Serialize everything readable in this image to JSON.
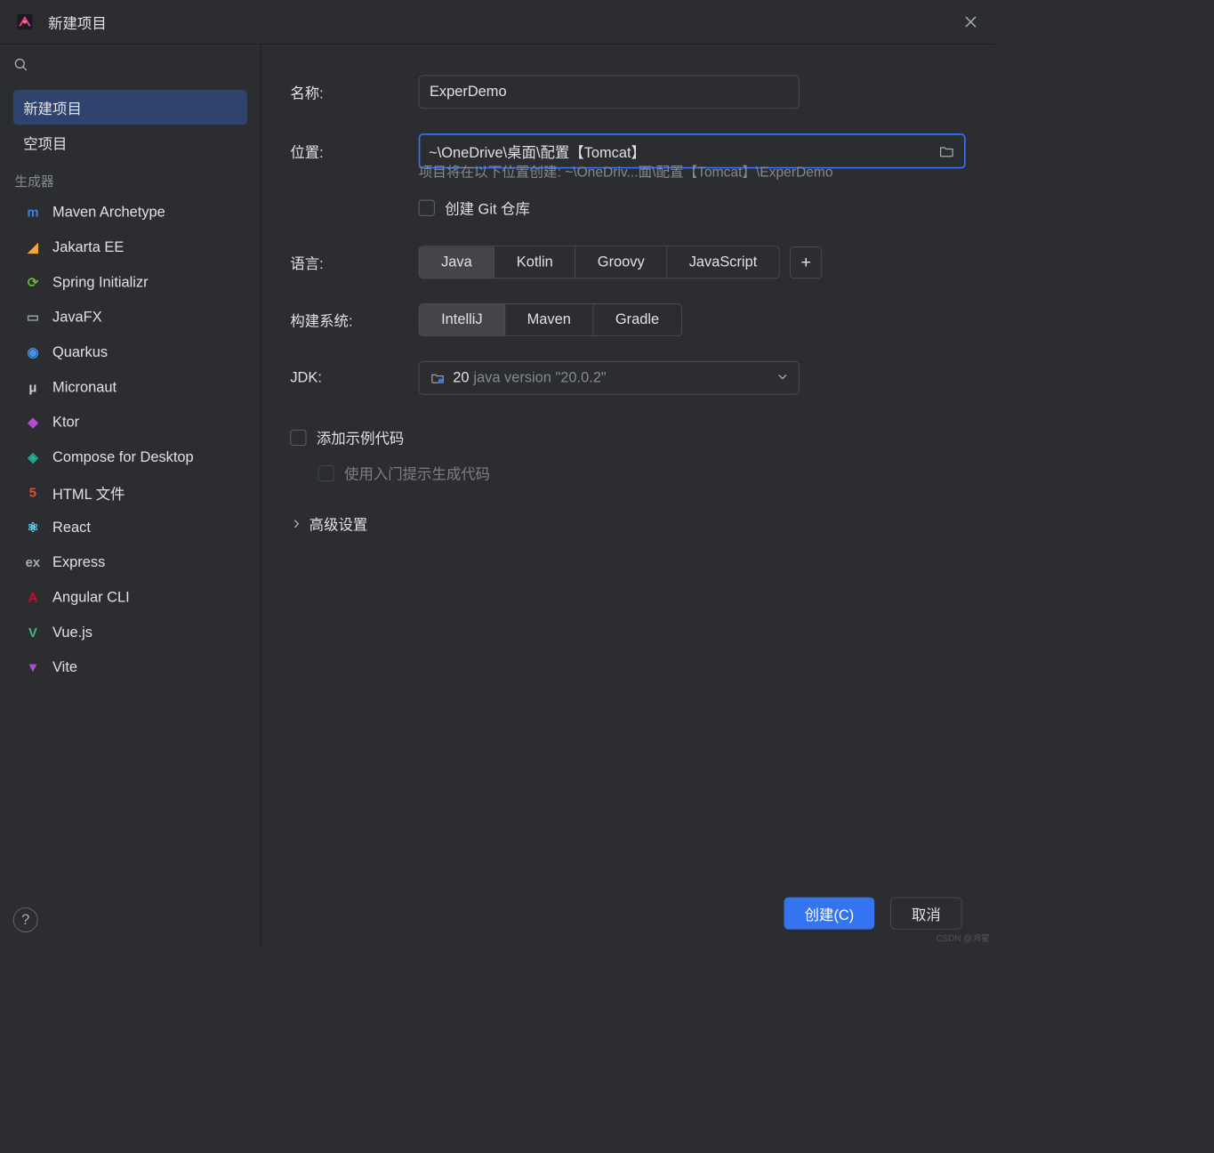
{
  "window": {
    "title": "新建项目"
  },
  "sidebar": {
    "top": [
      {
        "label": "新建项目"
      },
      {
        "label": "空项目"
      }
    ],
    "generators_header": "生成器",
    "generators": [
      {
        "label": "Maven Archetype",
        "color": "#3a84dc",
        "glyph": "m"
      },
      {
        "label": "Jakarta EE",
        "color": "#f2a53c",
        "glyph": "◢"
      },
      {
        "label": "Spring Initializr",
        "color": "#6db33f",
        "glyph": "⟳"
      },
      {
        "label": "JavaFX",
        "color": "#9aa0a6",
        "glyph": "▭"
      },
      {
        "label": "Quarkus",
        "color": "#4695eb",
        "glyph": "◉"
      },
      {
        "label": "Micronaut",
        "color": "#cfd2d6",
        "glyph": "μ"
      },
      {
        "label": "Ktor",
        "color": "#b44ad6",
        "glyph": "◆"
      },
      {
        "label": "Compose for Desktop",
        "color": "#1fb39a",
        "glyph": "◈"
      },
      {
        "label": "HTML 文件",
        "color": "#e44d26",
        "glyph": "5"
      },
      {
        "label": "React",
        "color": "#61dafb",
        "glyph": "⚛"
      },
      {
        "label": "Express",
        "color": "#a9adb3",
        "glyph": "ex"
      },
      {
        "label": "Angular CLI",
        "color": "#dd0031",
        "glyph": "A"
      },
      {
        "label": "Vue.js",
        "color": "#41b883",
        "glyph": "V"
      },
      {
        "label": "Vite",
        "color": "#b44ad6",
        "glyph": "▼"
      }
    ]
  },
  "form": {
    "name_label": "名称:",
    "name_value": "ExperDemo",
    "location_label": "位置:",
    "location_value": "~\\OneDrive\\桌面\\配置【Tomcat】",
    "location_hint": "项目将在以下位置创建: ~\\OneDriv...面\\配置【Tomcat】\\ExperDemo",
    "git_label": "创建 Git 仓库",
    "language_label": "语言:",
    "languages": [
      "Java",
      "Kotlin",
      "Groovy",
      "JavaScript"
    ],
    "language_selected": "Java",
    "build_label": "构建系统:",
    "builds": [
      "IntelliJ",
      "Maven",
      "Gradle"
    ],
    "build_selected": "IntelliJ",
    "jdk_label": "JDK:",
    "jdk_value": "20",
    "jdk_sub": "java version \"20.0.2\"",
    "sample_label": "添加示例代码",
    "sample_hint_label": "使用入门提示生成代码",
    "advanced_label": "高级设置"
  },
  "buttons": {
    "create": "创建(C)",
    "cancel": "取消"
  },
  "watermark": "CSDN @鸿蒙"
}
